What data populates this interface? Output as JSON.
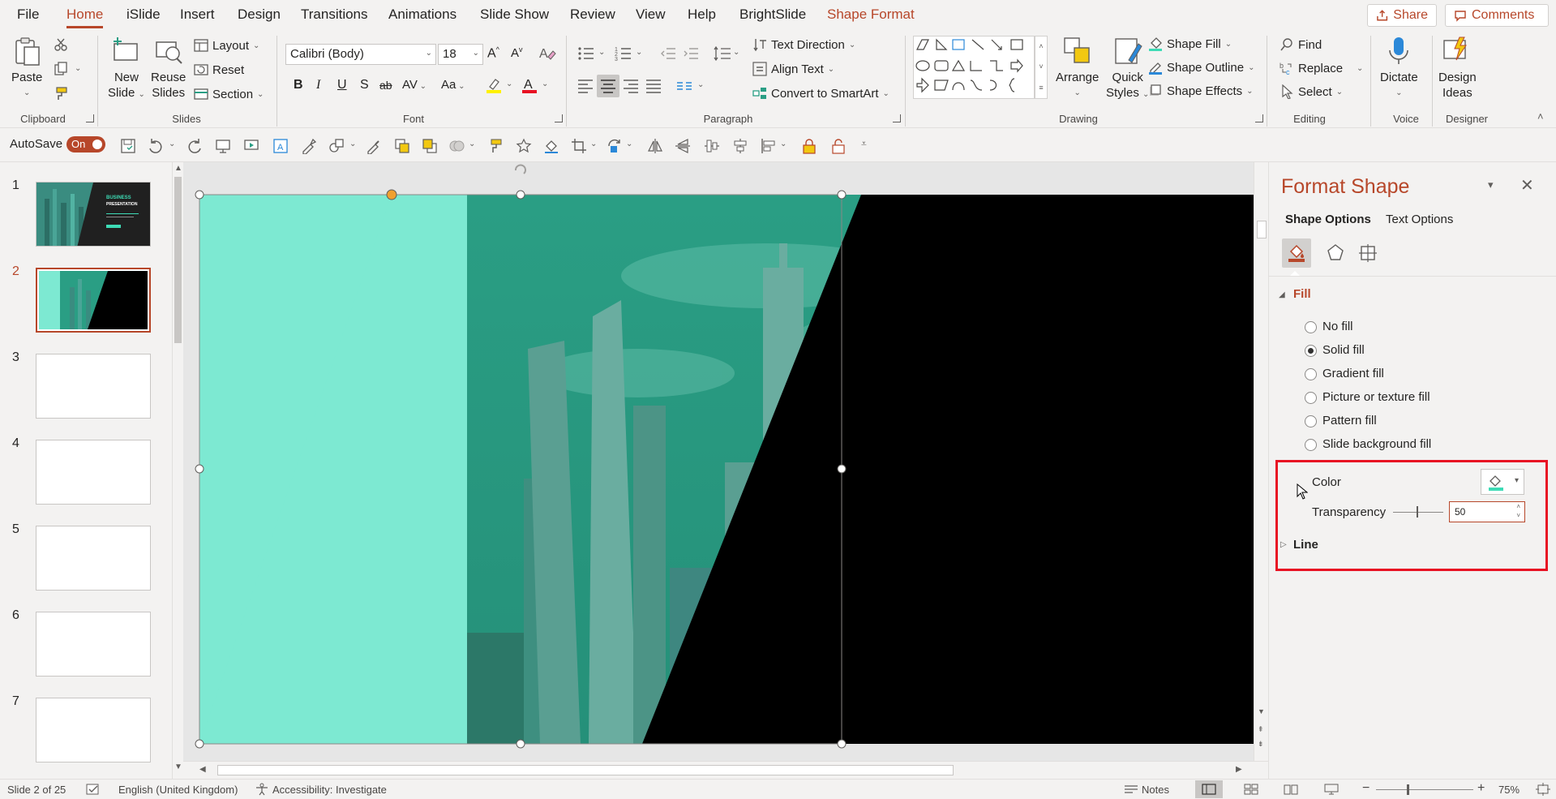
{
  "tabs": [
    "File",
    "Home",
    "iSlide",
    "Insert",
    "Design",
    "Transitions",
    "Animations",
    "Slide Show",
    "Review",
    "View",
    "Help",
    "BrightSlide",
    "Shape Format"
  ],
  "active_tab": "Home",
  "share_label": "Share",
  "comments_label": "Comments",
  "ribbon": {
    "clipboard": {
      "paste": "Paste",
      "label": "Clipboard"
    },
    "slides": {
      "new_slide_1": "New",
      "new_slide_2": "Slide",
      "reuse_1": "Reuse",
      "reuse_2": "Slides",
      "layout": "Layout",
      "reset": "Reset",
      "section": "Section",
      "label": "Slides"
    },
    "font": {
      "name": "Calibri (Body)",
      "size": "18",
      "label": "Font",
      "bold": "B",
      "italic": "I",
      "underline": "U",
      "strike": "S",
      "strike2": "ab",
      "spacing": "AV",
      "case": "Aa"
    },
    "paragraph": {
      "text_direction": "Text Direction",
      "align_text": "Align Text",
      "convert": "Convert to SmartArt",
      "label": "Paragraph"
    },
    "drawing": {
      "arrange": "Arrange",
      "quick_1": "Quick",
      "quick_2": "Styles",
      "shape_fill": "Shape Fill",
      "shape_outline": "Shape Outline",
      "shape_effects": "Shape Effects",
      "label": "Drawing"
    },
    "editing": {
      "find": "Find",
      "replace": "Replace",
      "select": "Select",
      "label": "Editing"
    },
    "voice": {
      "dictate": "Dictate",
      "label": "Voice"
    },
    "designer": {
      "ideas_1": "Design",
      "ideas_2": "Ideas",
      "label": "Designer"
    }
  },
  "qat": {
    "autosave": "AutoSave",
    "autosave_state": "On"
  },
  "thumbnails": [
    "1",
    "2",
    "3",
    "4",
    "5",
    "6",
    "7"
  ],
  "thumb1": {
    "line1": "BUSINESS",
    "line2": "PRESENTATION"
  },
  "selected_slide": "2",
  "pane": {
    "title": "Format Shape",
    "tab_shape": "Shape Options",
    "tab_text": "Text Options",
    "fill_header": "Fill",
    "options": [
      "No fill",
      "Solid fill",
      "Gradient fill",
      "Picture or texture fill",
      "Pattern fill",
      "Slide background fill"
    ],
    "selected_option": "Solid fill",
    "color_label": "Color",
    "transparency_label": "Transparency",
    "transparency_value": "50",
    "line_header": "Line",
    "fill_color": "#3ddbb5"
  },
  "colors": {
    "accent": "#b7472a",
    "teal_light": "#7de9d2",
    "teal_dark": "#2a9e84",
    "highlight": "#e81123"
  },
  "status": {
    "slide_info": "Slide 2 of 25",
    "language": "English (United Kingdom)",
    "accessibility": "Accessibility: Investigate",
    "notes": "Notes",
    "zoom": "75%"
  }
}
